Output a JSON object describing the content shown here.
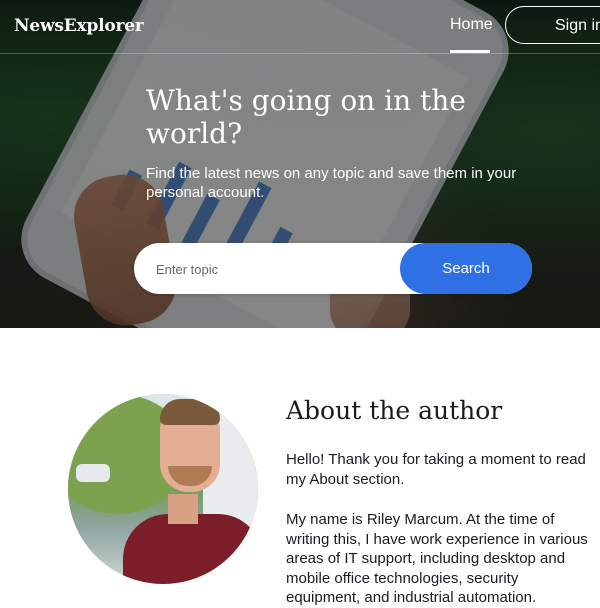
{
  "header": {
    "logo": "NewsExplorer",
    "nav_home": "Home",
    "sign_in": "Sign in"
  },
  "hero": {
    "title": "What's going on in the world?",
    "subtitle": "Find the latest news on any topic and save them in your personal account."
  },
  "search": {
    "placeholder": "Enter topic",
    "button": "Search"
  },
  "about": {
    "title": "About the author",
    "paragraph1": "Hello! Thank you for taking a moment to read my About section.",
    "paragraph2": "My name is Riley Marcum. At the time of writing this, I have work experience in various areas of IT support, including desktop and mobile office technologies, security equipment, and industrial automation."
  },
  "colors": {
    "accent": "#2f71e5",
    "text": "#1a1b22"
  }
}
